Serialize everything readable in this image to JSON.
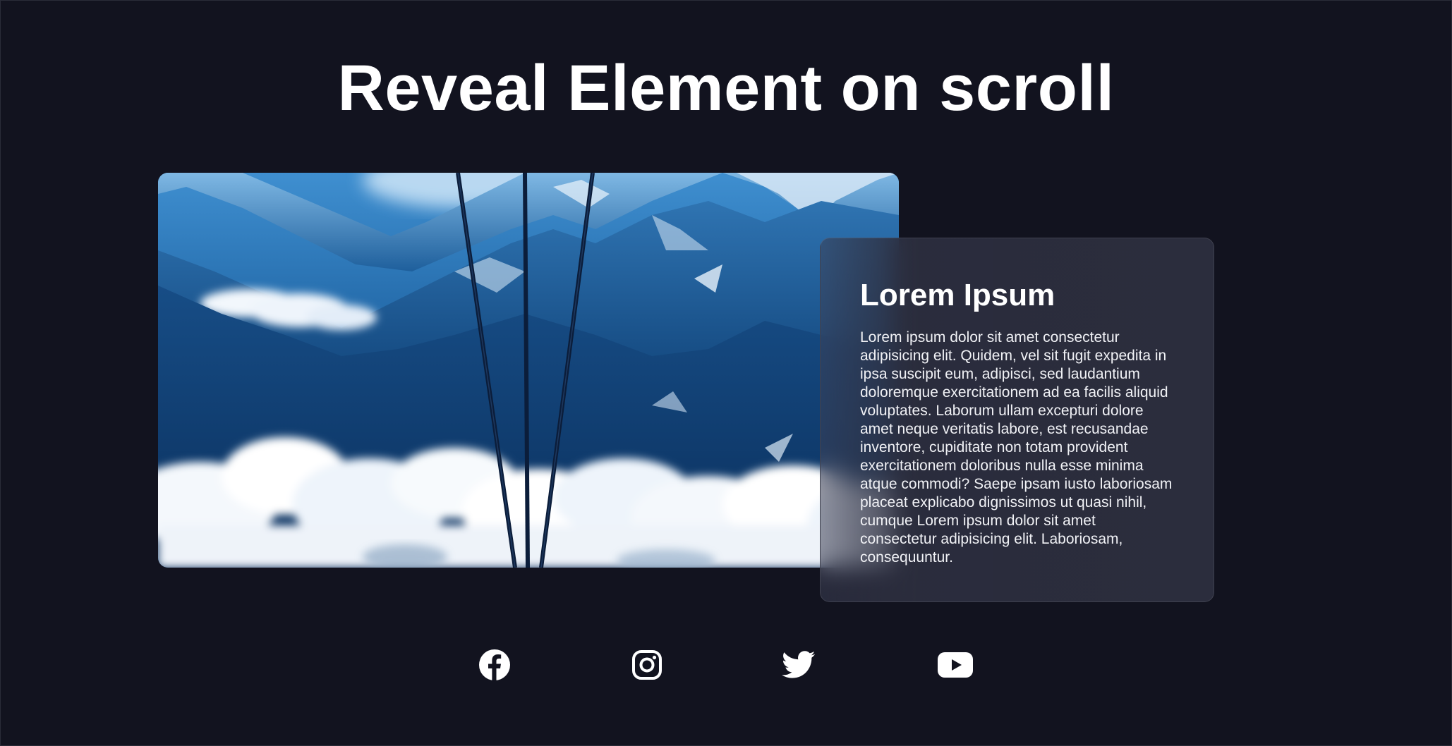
{
  "page": {
    "title": "Reveal Element on scroll"
  },
  "card": {
    "title": "Lorem Ipsum",
    "body": "Lorem ipsum dolor sit amet consectetur adipisicing elit. Quidem, vel sit fugit expedita in ipsa suscipit eum, adipisci, sed laudantium doloremque exercitationem ad ea facilis aliquid voluptates. Laborum ullam excepturi dolore amet neque veritatis labore, est recusandae inventore, cupiditate non totam provident exercitationem doloribus nulla esse minima atque commodi? Saepe ipsam iusto laboriosam placeat explicabo dignissimos ut quasi nihil, cumque Lorem ipsum dolor sit amet consectetur adipisicing elit. Laboriosam, consequuntur."
  },
  "image": {
    "subject": "snowy-mountains-cable-car-lines-above-clouds"
  },
  "social": [
    {
      "icon": "facebook-icon"
    },
    {
      "icon": "instagram-icon"
    },
    {
      "icon": "twitter-icon"
    },
    {
      "icon": "youtube-icon"
    }
  ],
  "colors": {
    "background": "#12131f",
    "card": "#2b2d3d",
    "text": "#ffffff"
  }
}
